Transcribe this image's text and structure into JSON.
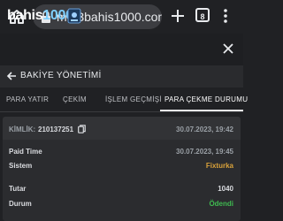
{
  "browser": {
    "url": "m.43bahis1000.com/t",
    "tabs_count": "8"
  },
  "site": {
    "logo_main": "bahis",
    "logo_sub": "1000"
  },
  "panel": {
    "title": "BAKİYE YÖNETİMİ"
  },
  "tabs": [
    {
      "label": "PARA YATIR",
      "active": false
    },
    {
      "label": "ÇEKİM",
      "active": false
    },
    {
      "label": "İŞLEM GEÇMİŞİ",
      "active": false
    },
    {
      "label": "PARA ÇEKME DURUMU",
      "active": true
    }
  ],
  "record": {
    "id_label": "KİMLİK:",
    "id_value": "210137251",
    "created": "30.07.2023, 19:42",
    "paid_time_label": "Paid Time",
    "paid_time_value": "30.07.2023, 19:45",
    "system_label": "Sistem",
    "system_value": "Fixturka",
    "amount_label": "Tutar",
    "amount_value": "1040",
    "status_label": "Durum",
    "status_value": "Ödendi"
  },
  "colors": {
    "system_value": "#d9a23a",
    "status_value": "#3fb950"
  }
}
